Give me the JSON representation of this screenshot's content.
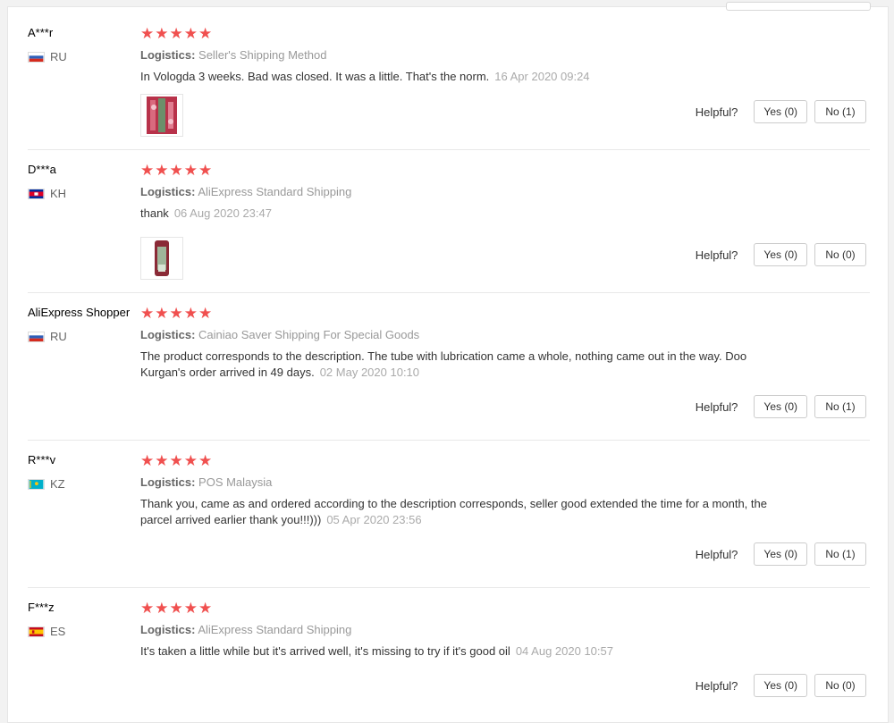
{
  "logistics_label": "Logistics:",
  "helpful_label": "Helpful?",
  "stars": "★★★★★",
  "colors": {
    "star": "#f0504f",
    "date": "#aaaaaa",
    "divider": "#e8e8e8"
  },
  "reviews": [
    {
      "user": "A***r",
      "country": "RU",
      "flag": "russia-flag",
      "rating": 5,
      "shipping": "Seller's Shipping Method",
      "text": "In Vologda 3 weeks. Bad was closed. It was a little. That's the norm.",
      "date": "16 Apr 2020 09:24",
      "has_photo": true,
      "yes": "Yes (0)",
      "no": "No (1)"
    },
    {
      "user": "D***a",
      "country": "KH",
      "flag": "cambodia-flag",
      "rating": 5,
      "shipping": "AliExpress Standard Shipping",
      "text": "thank",
      "date": "06 Aug 2020 23:47",
      "has_photo": true,
      "yes": "Yes (0)",
      "no": "No (0)"
    },
    {
      "user": "AliExpress Shopper",
      "country": "RU",
      "flag": "russia-flag",
      "rating": 5,
      "shipping": "Cainiao Saver Shipping For Special Goods",
      "text": "The product corresponds to the description. The tube with lubrication came a whole, nothing came out in the way. Doo Kurgan's order arrived in 49 days.",
      "date": "02 May 2020 10:10",
      "has_photo": false,
      "yes": "Yes (0)",
      "no": "No (1)"
    },
    {
      "user": "R***v",
      "country": "KZ",
      "flag": "kazakhstan-flag",
      "rating": 5,
      "shipping": "POS Malaysia",
      "text": "Thank you, came as and ordered according to the description corresponds, seller good extended the time for a month, the parcel arrived earlier thank you!!!)))",
      "date": "05 Apr 2020 23:56",
      "has_photo": false,
      "yes": "Yes (0)",
      "no": "No (1)"
    },
    {
      "user": "F***z",
      "country": "ES",
      "flag": "spain-flag",
      "rating": 5,
      "shipping": "AliExpress Standard Shipping",
      "text": "It's taken a little while but it's arrived well, it's missing to try if it's good oil",
      "date": "04 Aug 2020 10:57",
      "has_photo": false,
      "yes": "Yes (0)",
      "no": "No (0)"
    }
  ]
}
